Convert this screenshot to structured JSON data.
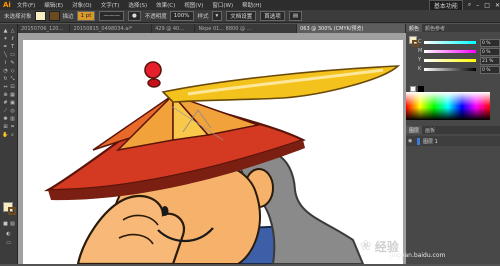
{
  "menubar": {
    "logo": "Ai",
    "items": [
      "文件(F)",
      "编辑(E)",
      "对象(O)",
      "文字(T)",
      "选择(S)",
      "效果(C)",
      "视图(V)",
      "窗口(W)",
      "帮助(H)"
    ],
    "workspace": "基本功能"
  },
  "control": {
    "selection_label": "未选择对象",
    "stroke_label": "描边",
    "stroke_value": "1 pt",
    "opacity_label": "不透明度",
    "opacity_value": "100%",
    "style_label": "样式",
    "doc_setup": "文档设置",
    "prefs": "首选项",
    "fill_color": "#f6edc4",
    "stroke_color": "#6a4a1e"
  },
  "tabs": [
    "20150706_120...",
    "20150815_0498034.ai*",
    "429 @ 40...",
    "Nkpe 01... 8800 @ ...",
    "063 @ 300% (CMYK/预览)"
  ],
  "active_tab_index": 4,
  "color_panel": {
    "tabs": [
      "颜色",
      "颜色参考"
    ],
    "channels": [
      {
        "name": "C",
        "value": "0 %"
      },
      {
        "name": "M",
        "value": "0 %"
      },
      {
        "name": "Y",
        "value": "21 %"
      },
      {
        "name": "K",
        "value": "0 %"
      }
    ]
  },
  "layers_panel": {
    "tabs": [
      "图层",
      "画板"
    ],
    "rows": [
      "图层 1"
    ]
  },
  "watermark": {
    "brand": "经验",
    "url": "jingyan.baidu.com"
  },
  "colors": {
    "hat_brim": "#d43a22",
    "hat_brim_dark": "#7a1f12",
    "hat_top": "#e35b2a",
    "feather": "#f4c21c",
    "feather_light": "#fde79a",
    "knob": "#e6202b",
    "face": "#f6b26b",
    "hair": "#8a8a8a",
    "robe": "#3d5fa8"
  }
}
